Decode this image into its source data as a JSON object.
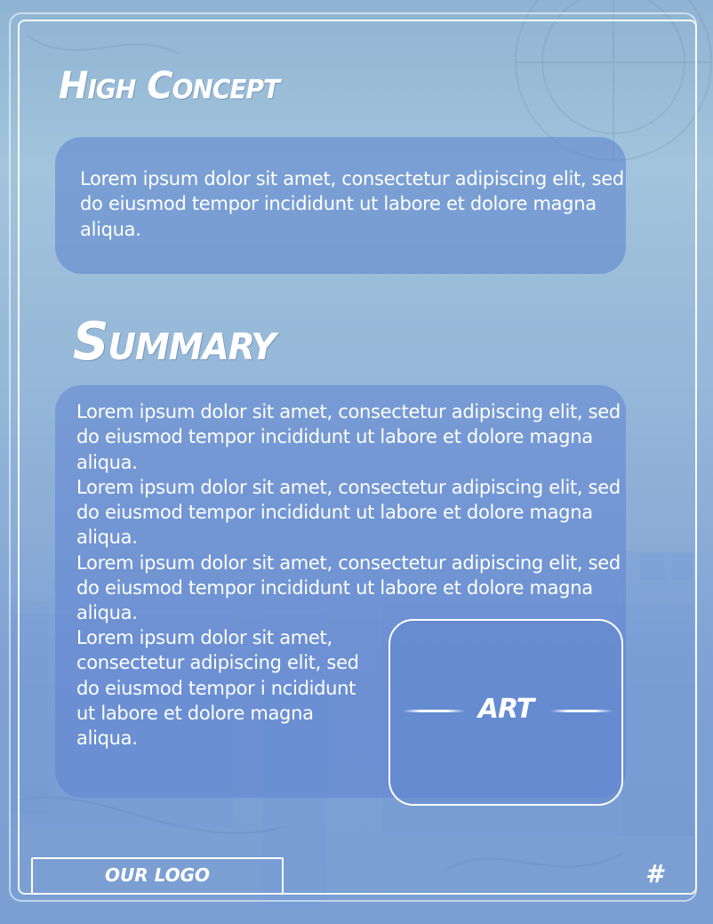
{
  "high_concept": {
    "heading": "High Concept",
    "text": "Lorem ipsum dolor sit amet, consectetur adipiscing elit, sed do eiusmod tempor incididunt ut labore et dolore magna aliqua."
  },
  "summary": {
    "heading": "Summary",
    "paragraphs": [
      "Lorem ipsum dolor sit amet, consectetur adipiscing elit, sed do eiusmod tempor incididunt ut labore et dolore magna aliqua.",
      "Lorem ipsum dolor sit amet, consectetur adipiscing elit, sed do eiusmod tempor incididunt ut labore et dolore magna aliqua.",
      "Lorem ipsum dolor sit amet, consectetur adipiscing elit, sed do eiusmod tempor incididunt ut labore et dolore magna aliqua."
    ],
    "narrow_paragraph": "Lorem ipsum dolor sit amet, consectetur adipiscing elit, sed do eiusmod tempor i ncididunt ut labore et dolore magna aliqua."
  },
  "art_placeholder": {
    "label": "ART"
  },
  "footer": {
    "logo_label": "OUR LOGO",
    "page_number": "#"
  },
  "colors": {
    "page_background": "#93b5d8",
    "text_box": "#5a82cd",
    "text": "#ffffff"
  }
}
